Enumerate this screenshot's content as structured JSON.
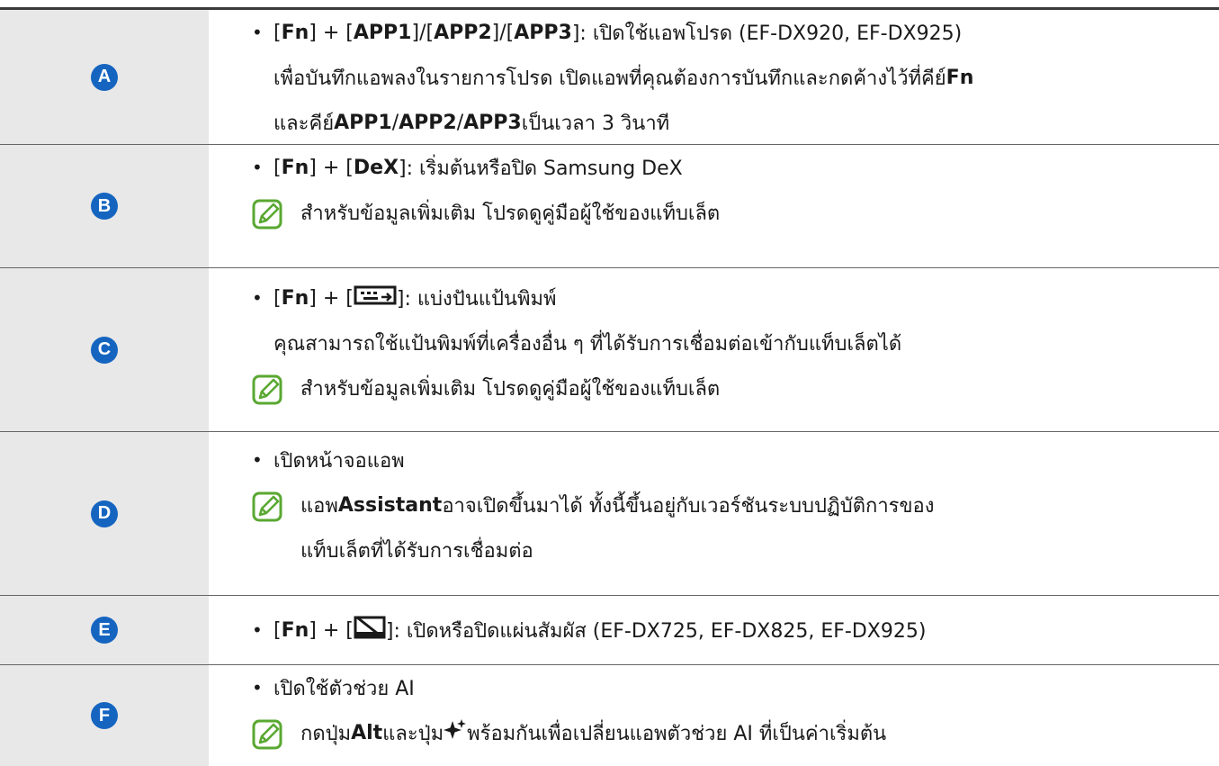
{
  "rows": [
    {
      "badge": "A",
      "bullet": "•",
      "prefix": "[",
      "fn": "Fn",
      "mid1": "] + [",
      "app1": "APP1",
      "slash1": "]/[",
      "app2": "APP2",
      "slash2": "]/[",
      "app3": "APP3",
      "desc": "]: เปิดใช้แอพโปรด (EF-DX920, EF-DX925)",
      "line2a": "เพื่อบันทึกแอพลงในรายการโปรด เปิดแอพที่คุณต้องการบันทึกและกดค้างไว้ที่คีย์ ",
      "line2b": "Fn",
      "line3a": "และคีย์ ",
      "line3b": "APP1",
      "line3c": "/",
      "line3d": "APP2",
      "line3e": "/",
      "line3f": "APP3",
      "line3g": " เป็นเวลา 3 วินาที"
    },
    {
      "badge": "B",
      "bullet": "•",
      "prefix": "[",
      "fn": "Fn",
      "mid": "] + [",
      "key": "DeX",
      "desc": "]: เริ่มต้นหรือปิด Samsung DeX",
      "note": "สำหรับข้อมูลเพิ่มเติม โปรดดูคู่มือผู้ใช้ของแท็บเล็ต"
    },
    {
      "badge": "C",
      "bullet": "•",
      "prefix": "[",
      "fn": "Fn",
      "mid": "] + [",
      "desc": "]: แบ่งปันแป้นพิมพ์",
      "line2": "คุณสามารถใช้แป้นพิมพ์ที่เครื่องอื่น ๆ ที่ได้รับการเชื่อมต่อเข้ากับแท็บเล็ตได้",
      "note": "สำหรับข้อมูลเพิ่มเติม โปรดดูคู่มือผู้ใช้ของแท็บเล็ต"
    },
    {
      "badge": "D",
      "bullet": "•",
      "desc": "เปิดหน้าจอแอพ",
      "note1a": "แอพ ",
      "note1b": "Assistant",
      "note1c": " อาจเปิดขึ้นมาได้ ทั้งนี้ขึ้นอยู่กับเวอร์ชันระบบปฏิบัติการของ",
      "note2": "แท็บเล็ตที่ได้รับการเชื่อมต่อ"
    },
    {
      "badge": "E",
      "bullet": "•",
      "prefix": "[",
      "fn": "Fn",
      "mid": "] + [",
      "desc": "]: เปิดหรือปิดแผ่นสัมผัส (EF-DX725, EF-DX825, EF-DX925)"
    },
    {
      "badge": "F",
      "bullet": "•",
      "desc": "เปิดใช้ตัวช่วย AI",
      "note_a": "กดปุ่ม ",
      "note_b": "Alt",
      "note_c": " และปุ่ม ",
      "note_d": " พร้อมกันเพื่อเปลี่ยนแอพตัวช่วย AI ที่เป็นค่าเริ่มต้น"
    }
  ],
  "colors": {
    "badge": "#1565c0",
    "note_icon": "#5aa832",
    "left_bg": "#e8e8e8"
  }
}
